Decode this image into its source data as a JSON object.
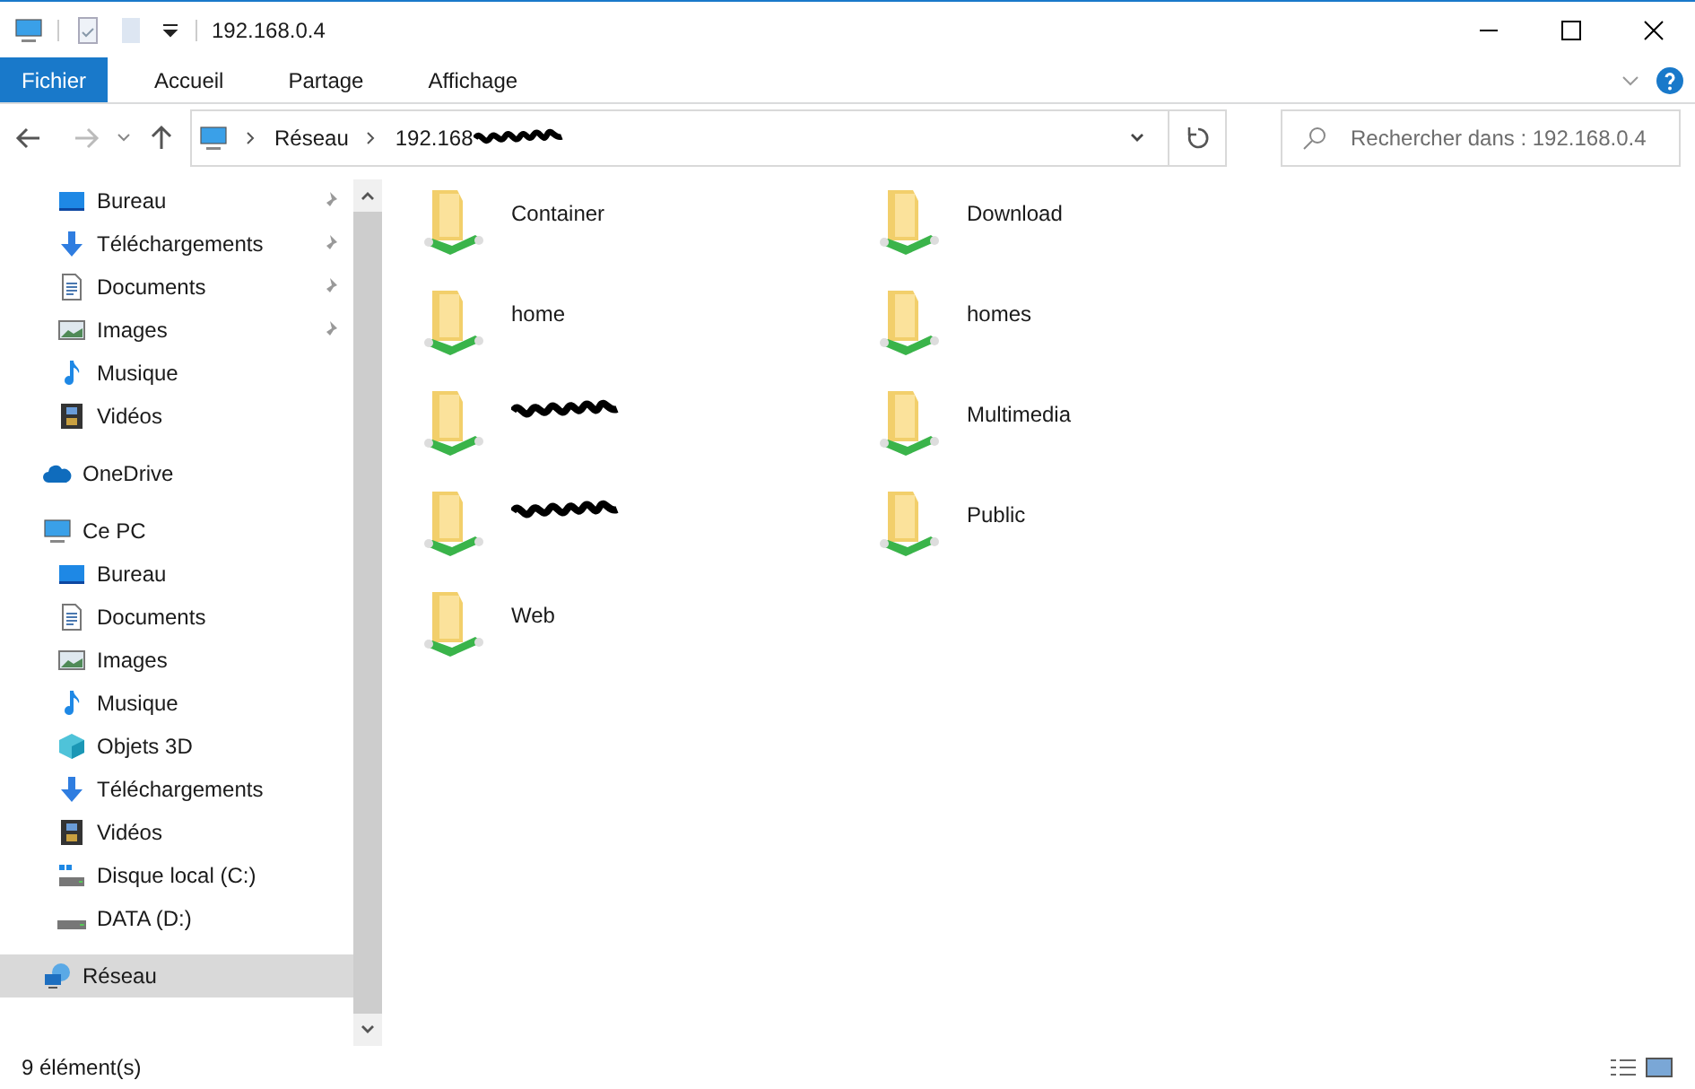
{
  "window": {
    "title": "192.168.0.4"
  },
  "ribbon_tabs": [
    {
      "label": "Fichier",
      "selected": true
    },
    {
      "label": "Accueil",
      "selected": false
    },
    {
      "label": "Partage",
      "selected": false
    },
    {
      "label": "Affichage",
      "selected": false
    }
  ],
  "address_bar": {
    "crumbs": [
      {
        "kind": "text",
        "label": "Réseau"
      },
      {
        "kind": "redacted",
        "label": "192.168"
      }
    ]
  },
  "search": {
    "placeholder": "Rechercher dans : 192.168.0.4"
  },
  "sidebar": {
    "quick_access": [
      {
        "label": "Bureau",
        "kind": "desktop",
        "pinned": true
      },
      {
        "label": "Téléchargements",
        "kind": "download",
        "pinned": true
      },
      {
        "label": "Documents",
        "kind": "documents",
        "pinned": true
      },
      {
        "label": "Images",
        "kind": "images",
        "pinned": true
      },
      {
        "label": "Musique",
        "kind": "music",
        "pinned": false
      },
      {
        "label": "Vidéos",
        "kind": "videos",
        "pinned": false
      }
    ],
    "items": [
      {
        "label": "OneDrive",
        "kind": "cloud",
        "selected": false
      },
      {
        "label": "Ce PC",
        "kind": "pc",
        "selected": false,
        "children": [
          {
            "label": "Bureau",
            "kind": "desktop"
          },
          {
            "label": "Documents",
            "kind": "documents"
          },
          {
            "label": "Images",
            "kind": "images"
          },
          {
            "label": "Musique",
            "kind": "music"
          },
          {
            "label": "Objets 3D",
            "kind": "cube"
          },
          {
            "label": "Téléchargements",
            "kind": "download"
          },
          {
            "label": "Vidéos",
            "kind": "videos"
          },
          {
            "label": "Disque local (C:)",
            "kind": "systemdisk"
          },
          {
            "label": "DATA (D:)",
            "kind": "disk"
          }
        ]
      },
      {
        "label": "Réseau",
        "kind": "network",
        "selected": true
      }
    ]
  },
  "folders": [
    {
      "kind": "named",
      "name": "Container"
    },
    {
      "kind": "named",
      "name": "Download"
    },
    {
      "kind": "named",
      "name": "home"
    },
    {
      "kind": "named",
      "name": "homes"
    },
    {
      "kind": "redacted"
    },
    {
      "kind": "named",
      "name": "Multimedia"
    },
    {
      "kind": "redacted"
    },
    {
      "kind": "named",
      "name": "Public"
    },
    {
      "kind": "named",
      "name": "Web"
    }
  ],
  "status_bar": {
    "count": "9 élément(s)"
  }
}
